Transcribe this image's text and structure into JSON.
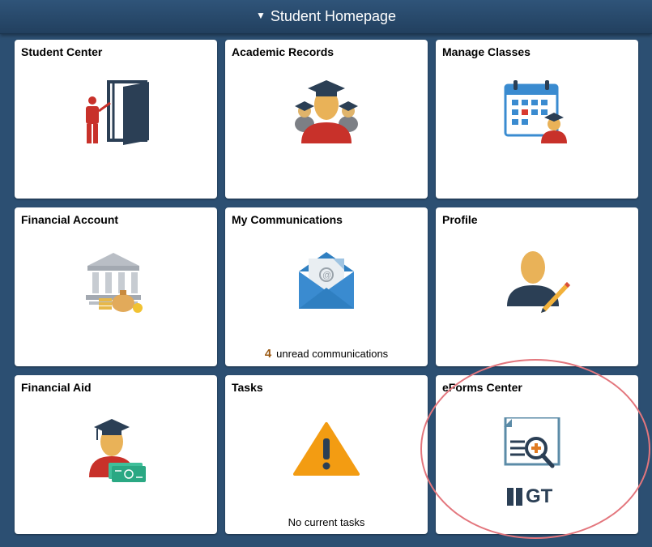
{
  "header": {
    "title": "Student Homepage",
    "caret_icon": "caret-down-icon"
  },
  "tiles": [
    {
      "title": "Student Center",
      "icon": "student-center-door-icon"
    },
    {
      "title": "Academic Records",
      "icon": "graduates-group-icon"
    },
    {
      "title": "Manage Classes",
      "icon": "calendar-graduate-icon"
    },
    {
      "title": "Financial Account",
      "icon": "bank-money-bag-icon"
    },
    {
      "title": "My Communications",
      "icon": "envelope-email-icon",
      "count": "4",
      "footer": "unread communications"
    },
    {
      "title": "Profile",
      "icon": "person-pencil-icon"
    },
    {
      "title": "Financial Aid",
      "icon": "graduate-cash-icon"
    },
    {
      "title": "Tasks",
      "icon": "warning-triangle-icon",
      "footer": "No current tasks"
    },
    {
      "title": "eForms Center",
      "icon": "eforms-document-search-icon",
      "brand": "GT"
    }
  ],
  "colors": {
    "background": "#2c4f72",
    "tile": "#ffffff",
    "highlight": "#e3767d"
  }
}
